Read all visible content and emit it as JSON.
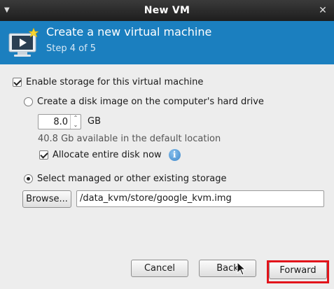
{
  "window": {
    "title": "New VM"
  },
  "banner": {
    "heading": "Create a new virtual machine",
    "step": "Step 4 of 5"
  },
  "storage": {
    "enable_label": "Enable storage for this virtual machine",
    "enable_checked": true,
    "create_disk_label": "Create a disk image on the computer's hard drive",
    "disk_size_value": "8.0",
    "disk_size_unit": "GB",
    "available_text": "40.8 Gb available in the default location",
    "allocate_label": "Allocate entire disk now",
    "allocate_checked": true,
    "select_existing_label": "Select managed or other existing storage",
    "browse_label": "Browse...",
    "path_value": "/data_kvm/store/google_kvm.img"
  },
  "buttons": {
    "cancel": "Cancel",
    "back": "Back",
    "forward": "Forward"
  },
  "colors": {
    "banner": "#1b7fbf",
    "highlight": "#e2141b"
  }
}
